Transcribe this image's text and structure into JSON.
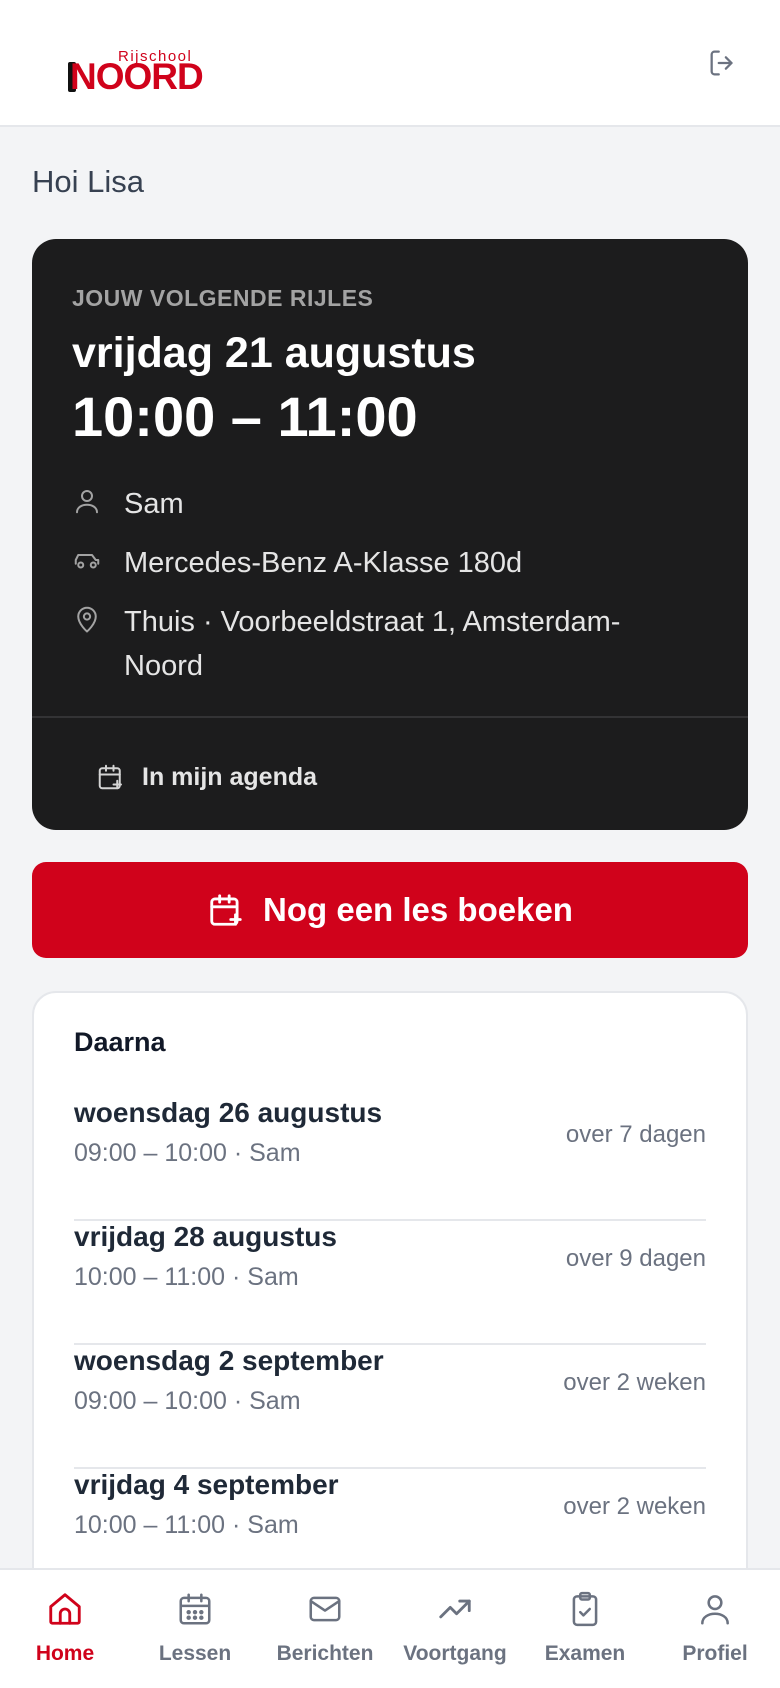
{
  "header": {
    "logo_small": "Rijschool",
    "logo_big": "NOORD"
  },
  "greeting": "Hoi Lisa",
  "next_lesson": {
    "kicker": "JOUW VOLGENDE RIJLES",
    "date": "vrijdag 21 augustus",
    "time": "10:00 – 11:00",
    "instructor": "Sam",
    "car": "Mercedes-Benz A-Klasse 180d",
    "location": "Thuis · Voorbeeldstraat 1, Amsterdam-Noord",
    "agenda_label": "In mijn agenda"
  },
  "book_button": "Nog een les boeken",
  "upcoming": {
    "title": "Daarna",
    "items": [
      {
        "date": "woensdag 26 augustus",
        "meta": "09:00 – 10:00 · Sam",
        "relative": "over 7 dagen"
      },
      {
        "date": "vrijdag 28 augustus",
        "meta": "10:00 – 11:00 · Sam",
        "relative": "over 9 dagen"
      },
      {
        "date": "woensdag 2 september",
        "meta": "09:00 – 10:00 · Sam",
        "relative": "over 2 weken"
      },
      {
        "date": "vrijdag 4 september",
        "meta": "10:00 – 11:00 · Sam",
        "relative": "over 2 weken"
      }
    ]
  },
  "nav": {
    "items": [
      {
        "label": "Home",
        "icon": "home-icon",
        "active": true
      },
      {
        "label": "Lessen",
        "icon": "calendar-icon",
        "active": false
      },
      {
        "label": "Berichten",
        "icon": "mail-icon",
        "active": false
      },
      {
        "label": "Voortgang",
        "icon": "trending-up-icon",
        "active": false
      },
      {
        "label": "Examen",
        "icon": "clipboard-check-icon",
        "active": false
      },
      {
        "label": "Profiel",
        "icon": "user-icon",
        "active": false
      }
    ]
  },
  "colors": {
    "brand": "#d0021b",
    "card_dark": "#1c1c1d",
    "background": "#f3f4f6"
  }
}
